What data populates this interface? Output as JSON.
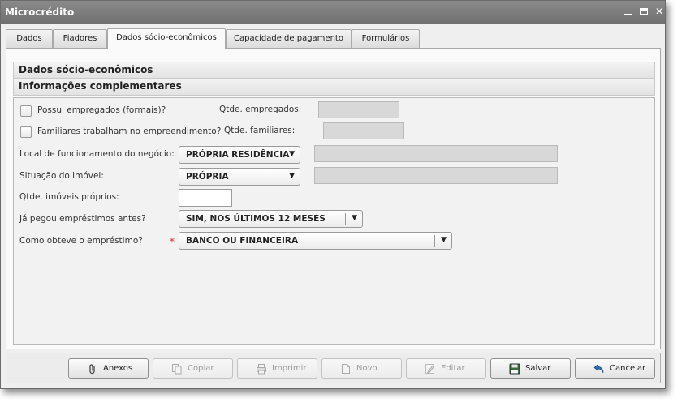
{
  "window": {
    "title": "Microcrédito"
  },
  "tabs": [
    {
      "label": "Dados"
    },
    {
      "label": "Fiadores"
    },
    {
      "label": "Dados sócio-econômicos",
      "active": true
    },
    {
      "label": "Capacidade de pagamento"
    },
    {
      "label": "Formulários"
    }
  ],
  "sections": {
    "main": "Dados sócio-econômicos",
    "sub": "Informações complementares"
  },
  "form": {
    "possui_empregados": {
      "label": "Possui empregados (formais)?",
      "checked": false
    },
    "qtde_empregados": {
      "label": "Qtde. empregados:",
      "value": ""
    },
    "familiares_trabalham": {
      "label": "Familiares trabalham no empreendimento?",
      "checked": false
    },
    "qtde_familiares": {
      "label": "Qtde. familiares:",
      "value": ""
    },
    "local_funcionamento": {
      "label": "Local de funcionamento do negócio:",
      "value": "PRÓPRIA RESIDÊNCIA",
      "extra": ""
    },
    "situacao_imovel": {
      "label": "Situação do imóvel:",
      "value": "PRÓPRIA",
      "extra": ""
    },
    "qtde_imoveis": {
      "label": "Qtde. imóveis próprios:",
      "value": ""
    },
    "emprestimos_antes": {
      "label": "Já pegou empréstimos antes?",
      "value": "SIM, NOS ÚLTIMOS 12 MESES"
    },
    "como_obteve": {
      "label": "Como obteve o empréstimo?",
      "value": "BANCO OU FINANCEIRA",
      "required_mark": "*"
    }
  },
  "buttons": {
    "anexos": "Anexos",
    "copiar": "Copiar",
    "imprimir": "Imprimir",
    "novo": "Novo",
    "editar": "Editar",
    "salvar": "Salvar",
    "cancelar": "Cancelar"
  },
  "icons": {
    "anexos": "paperclip-icon",
    "copiar": "copy-icon",
    "imprimir": "printer-icon",
    "novo": "new-document-icon",
    "editar": "pencil-icon",
    "salvar": "floppy-disk-icon",
    "cancelar": "undo-arrow-icon"
  }
}
